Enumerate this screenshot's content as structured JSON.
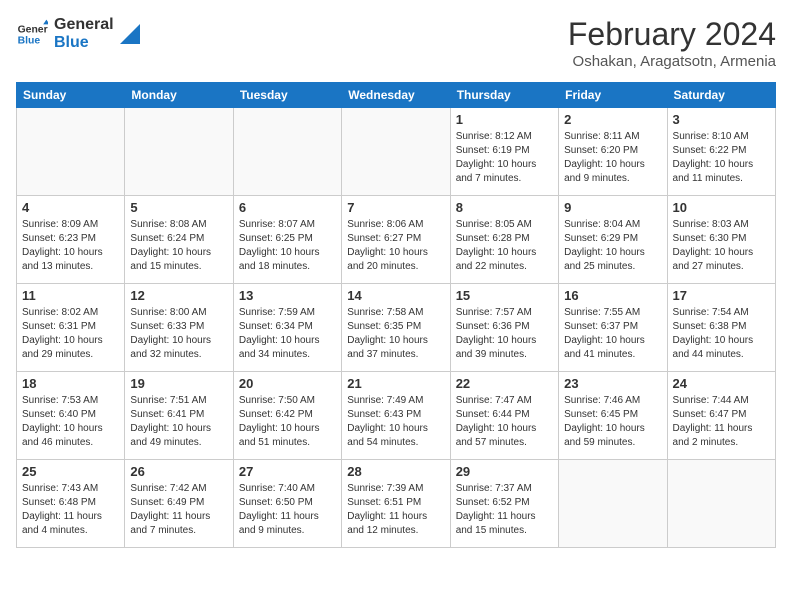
{
  "header": {
    "logo_line1": "General",
    "logo_line2": "Blue",
    "month_year": "February 2024",
    "location": "Oshakan, Aragatsotn, Armenia"
  },
  "days_of_week": [
    "Sunday",
    "Monday",
    "Tuesday",
    "Wednesday",
    "Thursday",
    "Friday",
    "Saturday"
  ],
  "weeks": [
    [
      {
        "day": "",
        "info": ""
      },
      {
        "day": "",
        "info": ""
      },
      {
        "day": "",
        "info": ""
      },
      {
        "day": "",
        "info": ""
      },
      {
        "day": "1",
        "info": "Sunrise: 8:12 AM\nSunset: 6:19 PM\nDaylight: 10 hours and 7 minutes."
      },
      {
        "day": "2",
        "info": "Sunrise: 8:11 AM\nSunset: 6:20 PM\nDaylight: 10 hours and 9 minutes."
      },
      {
        "day": "3",
        "info": "Sunrise: 8:10 AM\nSunset: 6:22 PM\nDaylight: 10 hours and 11 minutes."
      }
    ],
    [
      {
        "day": "4",
        "info": "Sunrise: 8:09 AM\nSunset: 6:23 PM\nDaylight: 10 hours and 13 minutes."
      },
      {
        "day": "5",
        "info": "Sunrise: 8:08 AM\nSunset: 6:24 PM\nDaylight: 10 hours and 15 minutes."
      },
      {
        "day": "6",
        "info": "Sunrise: 8:07 AM\nSunset: 6:25 PM\nDaylight: 10 hours and 18 minutes."
      },
      {
        "day": "7",
        "info": "Sunrise: 8:06 AM\nSunset: 6:27 PM\nDaylight: 10 hours and 20 minutes."
      },
      {
        "day": "8",
        "info": "Sunrise: 8:05 AM\nSunset: 6:28 PM\nDaylight: 10 hours and 22 minutes."
      },
      {
        "day": "9",
        "info": "Sunrise: 8:04 AM\nSunset: 6:29 PM\nDaylight: 10 hours and 25 minutes."
      },
      {
        "day": "10",
        "info": "Sunrise: 8:03 AM\nSunset: 6:30 PM\nDaylight: 10 hours and 27 minutes."
      }
    ],
    [
      {
        "day": "11",
        "info": "Sunrise: 8:02 AM\nSunset: 6:31 PM\nDaylight: 10 hours and 29 minutes."
      },
      {
        "day": "12",
        "info": "Sunrise: 8:00 AM\nSunset: 6:33 PM\nDaylight: 10 hours and 32 minutes."
      },
      {
        "day": "13",
        "info": "Sunrise: 7:59 AM\nSunset: 6:34 PM\nDaylight: 10 hours and 34 minutes."
      },
      {
        "day": "14",
        "info": "Sunrise: 7:58 AM\nSunset: 6:35 PM\nDaylight: 10 hours and 37 minutes."
      },
      {
        "day": "15",
        "info": "Sunrise: 7:57 AM\nSunset: 6:36 PM\nDaylight: 10 hours and 39 minutes."
      },
      {
        "day": "16",
        "info": "Sunrise: 7:55 AM\nSunset: 6:37 PM\nDaylight: 10 hours and 41 minutes."
      },
      {
        "day": "17",
        "info": "Sunrise: 7:54 AM\nSunset: 6:38 PM\nDaylight: 10 hours and 44 minutes."
      }
    ],
    [
      {
        "day": "18",
        "info": "Sunrise: 7:53 AM\nSunset: 6:40 PM\nDaylight: 10 hours and 46 minutes."
      },
      {
        "day": "19",
        "info": "Sunrise: 7:51 AM\nSunset: 6:41 PM\nDaylight: 10 hours and 49 minutes."
      },
      {
        "day": "20",
        "info": "Sunrise: 7:50 AM\nSunset: 6:42 PM\nDaylight: 10 hours and 51 minutes."
      },
      {
        "day": "21",
        "info": "Sunrise: 7:49 AM\nSunset: 6:43 PM\nDaylight: 10 hours and 54 minutes."
      },
      {
        "day": "22",
        "info": "Sunrise: 7:47 AM\nSunset: 6:44 PM\nDaylight: 10 hours and 57 minutes."
      },
      {
        "day": "23",
        "info": "Sunrise: 7:46 AM\nSunset: 6:45 PM\nDaylight: 10 hours and 59 minutes."
      },
      {
        "day": "24",
        "info": "Sunrise: 7:44 AM\nSunset: 6:47 PM\nDaylight: 11 hours and 2 minutes."
      }
    ],
    [
      {
        "day": "25",
        "info": "Sunrise: 7:43 AM\nSunset: 6:48 PM\nDaylight: 11 hours and 4 minutes."
      },
      {
        "day": "26",
        "info": "Sunrise: 7:42 AM\nSunset: 6:49 PM\nDaylight: 11 hours and 7 minutes."
      },
      {
        "day": "27",
        "info": "Sunrise: 7:40 AM\nSunset: 6:50 PM\nDaylight: 11 hours and 9 minutes."
      },
      {
        "day": "28",
        "info": "Sunrise: 7:39 AM\nSunset: 6:51 PM\nDaylight: 11 hours and 12 minutes."
      },
      {
        "day": "29",
        "info": "Sunrise: 7:37 AM\nSunset: 6:52 PM\nDaylight: 11 hours and 15 minutes."
      },
      {
        "day": "",
        "info": ""
      },
      {
        "day": "",
        "info": ""
      }
    ]
  ]
}
